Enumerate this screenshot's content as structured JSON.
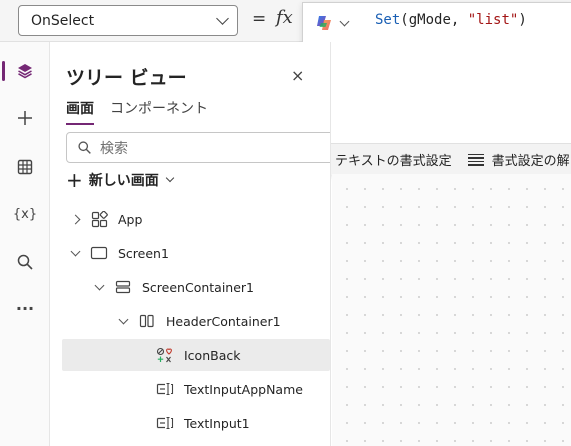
{
  "formula_bar": {
    "property": "OnSelect",
    "equals": "=",
    "fx": "fx"
  },
  "editor": {
    "code": {
      "fn": "Set",
      "open": "(",
      "arg1": "gMode, ",
      "arg2": "\"list\"",
      "close": ")"
    },
    "format_text": "テキストの書式設定",
    "remove_format": "書式設定の解"
  },
  "rail": {
    "items": [
      {
        "name": "tree-view",
        "icon": "layers-icon"
      },
      {
        "name": "insert",
        "icon": "plus-icon"
      },
      {
        "name": "data",
        "icon": "table-icon"
      },
      {
        "name": "variables",
        "icon": "variables-icon",
        "text": "{x}"
      },
      {
        "name": "search",
        "icon": "search-icon"
      },
      {
        "name": "more",
        "icon": "more-icon",
        "text": "···"
      }
    ]
  },
  "panel": {
    "title": "ツリー ビュー",
    "close": "×",
    "tabs": [
      {
        "label": "画面",
        "active": true
      },
      {
        "label": "コンポーネント",
        "active": false
      }
    ],
    "search_placeholder": "検索",
    "new_screen": "新しい画面"
  },
  "tree": {
    "items": [
      {
        "label": "App",
        "icon": "app-icon",
        "expander": "right",
        "selected": false
      },
      {
        "label": "Screen1",
        "icon": "screen-icon",
        "expander": "down",
        "selected": false
      },
      {
        "label": "ScreenContainer1",
        "icon": "vertical-container-icon",
        "expander": "down",
        "selected": false
      },
      {
        "label": "HeaderContainer1",
        "icon": "horizontal-container-icon",
        "expander": "down",
        "selected": false
      },
      {
        "label": "IconBack",
        "icon": "icon-control-icon",
        "expander": "none",
        "selected": true
      },
      {
        "label": "TextInputAppName",
        "icon": "text-input-icon",
        "expander": "none",
        "selected": false
      },
      {
        "label": "TextInput1",
        "icon": "text-input-icon",
        "expander": "none",
        "selected": false
      }
    ]
  },
  "colors": {
    "accent": "#742774",
    "selected_row": "#ebebeb",
    "code_function": "#1a5fb4",
    "code_string": "#a31515"
  }
}
